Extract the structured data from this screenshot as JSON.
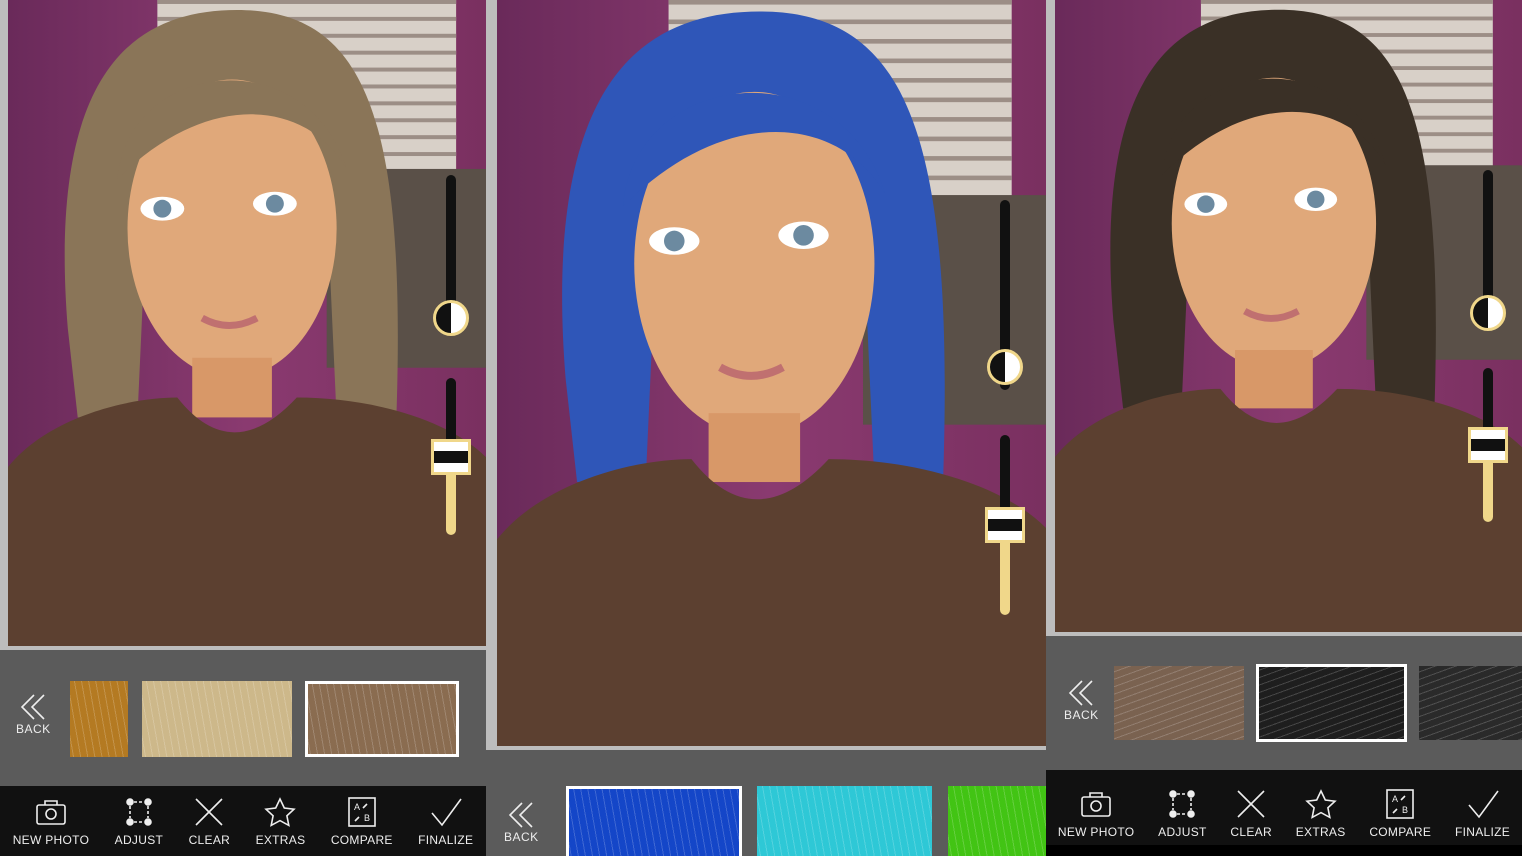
{
  "labels": {
    "back": "BACK",
    "new_photo": "NEW PHOTO",
    "adjust": "ADJUST",
    "clear": "CLEAR",
    "extras": "EXTRAS",
    "compare": "COMPARE",
    "finalize": "FINALIZE"
  },
  "panels": [
    {
      "hair_color": "#8a7558",
      "swatches": [
        {
          "color": "#b47a22"
        },
        {
          "color": "#cdb88a"
        },
        {
          "color": "#8a6c50",
          "selected": true
        }
      ],
      "sliders": [
        {
          "type": "round",
          "value": 0.08
        },
        {
          "type": "rect",
          "value": 0.5
        }
      ],
      "toolbar": true
    },
    {
      "hair_color": "#2f56b8",
      "swatches": [
        {
          "color": "#1446c8",
          "selected": true
        },
        {
          "color": "#2ec8d6"
        },
        {
          "color": "#42c414"
        }
      ],
      "sliders": [
        {
          "type": "round",
          "value": 0.12
        },
        {
          "type": "rect",
          "value": 0.5
        }
      ],
      "toolbar": false
    },
    {
      "hair_color": "#3a3026",
      "swatches": [
        {
          "color": "#7a6250"
        },
        {
          "color": "#1e1e1e",
          "selected": true
        },
        {
          "color": "#2a2a2a"
        }
      ],
      "sliders": [
        {
          "type": "round",
          "value": 0.08
        },
        {
          "type": "rect",
          "value": 0.5
        }
      ],
      "toolbar": true
    }
  ]
}
